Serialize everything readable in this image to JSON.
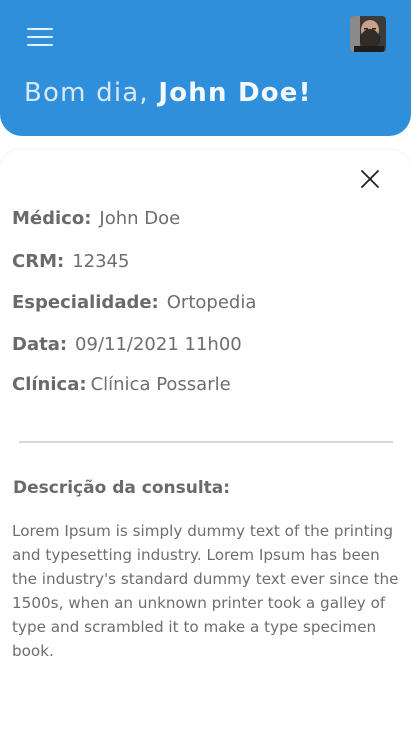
{
  "header": {
    "greeting_prefix": "Bom dia,",
    "user_name": "John Doe!",
    "background_color": "#2f8fdb",
    "menu_icon": "hamburger-menu-icon",
    "avatar_icon": "user-avatar"
  },
  "details": {
    "close_icon": "close-icon",
    "doctor_label": "Médico:",
    "doctor_value": "John Doe",
    "crm_label": "CRM:",
    "crm_value": "12345",
    "specialty_label": "Especialidade:",
    "specialty_value": "Ortopedia",
    "date_label": "Data:",
    "date_value": "09/11/2021 11h00",
    "clinic_label": "Clínica:",
    "clinic_value": "Clínica Possarle"
  },
  "description": {
    "title": "Descrição da consulta:",
    "text": "Lorem Ipsum is simply dummy text of the printing and typesetting industry. Lorem Ipsum has been the industry's standard dummy text ever since the 1500s, when an unknown printer took a galley of type and scrambled it to make a type specimen book."
  }
}
